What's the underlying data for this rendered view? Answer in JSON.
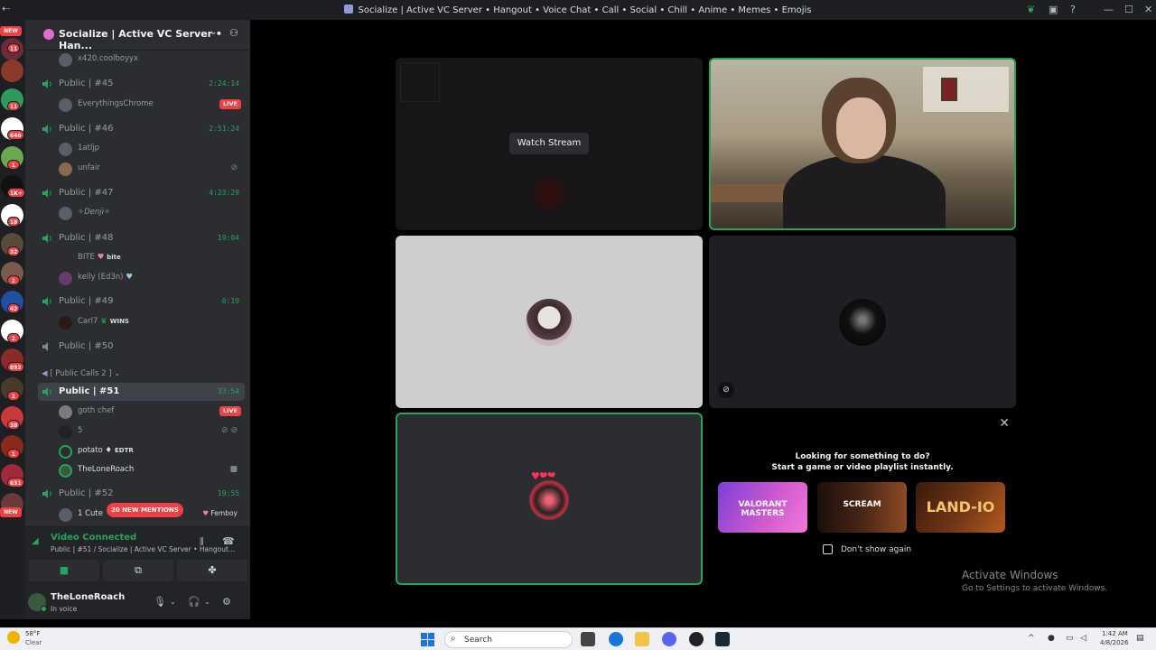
{
  "window": {
    "title": "Socialize | Active VC Server • Hangout • Voice Chat • Call • Social • Chill • Anime • Memes • Emojis"
  },
  "rail": {
    "new_top": "NEW",
    "badges": [
      "11",
      "11",
      "646",
      "1",
      "1K+",
      "18",
      "32",
      "2",
      "42",
      "2",
      "892",
      "2",
      "38",
      "1",
      "631"
    ],
    "new_bottom": "NEW"
  },
  "server": {
    "name": "Socialize | Active VC Server • Han..."
  },
  "channels": {
    "top_user": "x420.coolboyyx",
    "c45": {
      "name": "Public | #45",
      "time": "2:24:14",
      "u1": "EverythingsChrome",
      "live": "LIVE"
    },
    "c46": {
      "name": "Public | #46",
      "time": "2:51:24",
      "u1": "1atljp",
      "u2": "unfair"
    },
    "c47": {
      "name": "Public | #47",
      "time": "4:23:29",
      "u1": "✧Denji✧"
    },
    "c48": {
      "name": "Public | #48",
      "time": "19:04",
      "u1": "BITE",
      "u1_tag": "bite",
      "u2": "kelly (Ed3n)"
    },
    "c49": {
      "name": "Public | #49",
      "time": "0:19",
      "u1": "Carl7",
      "u1_tag": "WINS"
    },
    "c50": {
      "name": "Public | #50"
    },
    "category": "[ Public Calls 2 ]",
    "c51": {
      "name": "Public | #51",
      "time": "33:54",
      "u1": "goth chef",
      "live": "LIVE",
      "u2": "5",
      "u3": "potato",
      "u3_tag": "EDTR",
      "u4": "TheLoneRoach"
    },
    "c52": {
      "name": "Public | #52",
      "time": "19:55",
      "u1": "1 Cute",
      "u1_tag": "Femboy"
    },
    "mentions": "20 NEW MENTIONS"
  },
  "voice": {
    "status": "Video Connected",
    "location": "Public | #51 / Socialize | Active VC Server • Hangout..."
  },
  "user": {
    "name": "TheLoneRoach",
    "status": "In voice"
  },
  "stage": {
    "watch_stream": "Watch Stream"
  },
  "activity": {
    "line1": "Looking for something to do?",
    "line2": "Start a game or video playlist instantly.",
    "cards": [
      "VALORANT MASTERS",
      "SCREAM",
      "LAND-IO"
    ],
    "dont_show": "Don't show again"
  },
  "watermark": {
    "line1": "Activate Windows",
    "line2": "Go to Settings to activate Windows."
  },
  "taskbar": {
    "temp": "58°F",
    "condition": "Clear",
    "search": "Search",
    "time": "1:42 AM",
    "date": "4/8/2026"
  },
  "colors": {
    "accent_green": "#23a55a",
    "live_red": "#f23f43",
    "sidebar_bg": "#2b2d31"
  }
}
